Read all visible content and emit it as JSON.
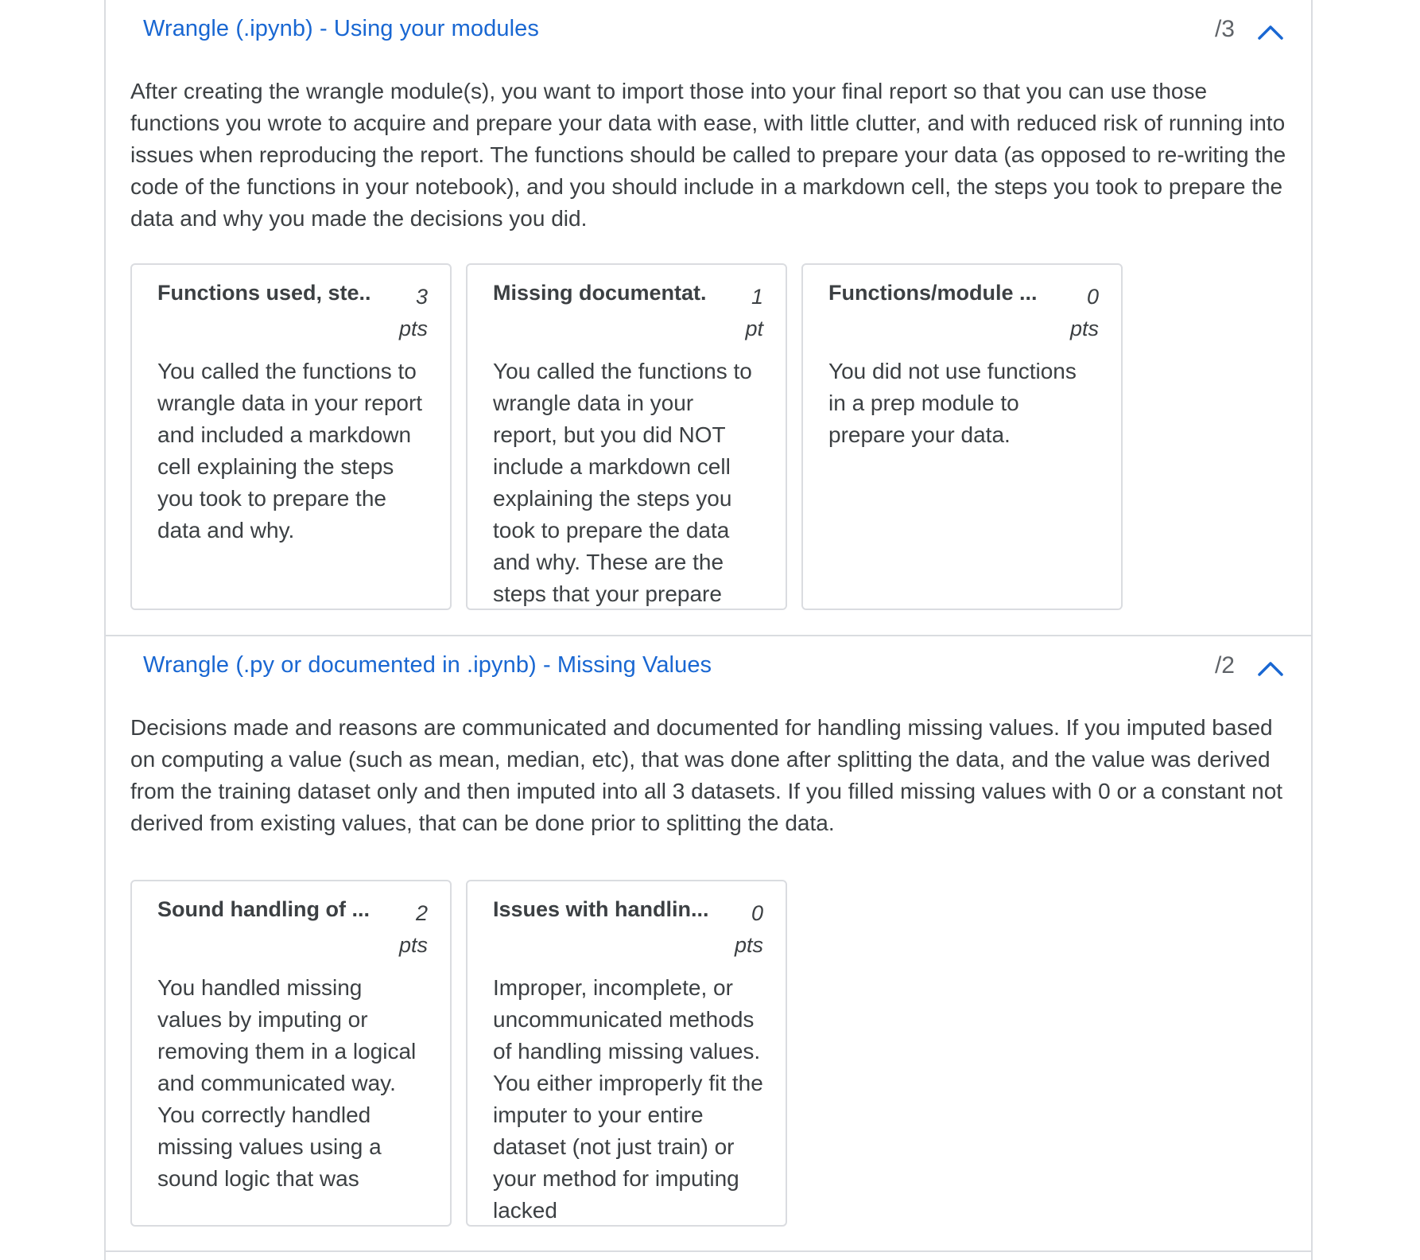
{
  "criteria": [
    {
      "title": "Wrangle (.ipynb) - Using your modules",
      "points": "/3",
      "description": "After creating the wrangle module(s), you want to import those into your final report so that you can use those functions you wrote to acquire and prepare your data with ease, with little clutter, and with reduced risk of running into issues when reproducing the report. The functions should be called to prepare your data (as opposed to re-writing the code of the functions in your notebook), and you should include in a markdown cell, the steps you took to prepare the data and why you made the decisions you did.",
      "ratings": [
        {
          "title": "Functions used, ste...",
          "points_value": "3",
          "points_unit": "pts",
          "description": "You called the functions to wrangle data in your report and included a markdown cell explaining the steps you took to prepare the data and why."
        },
        {
          "title": "Missing documentat...",
          "points_value": "1",
          "points_unit": "pt",
          "description": "You called the functions to wrangle data in your report, but you did NOT include a markdown cell explaining the steps you took to prepare the data and why. These are the steps that your prepare"
        },
        {
          "title": "Functions/module ...",
          "points_value": "0",
          "points_unit": "pts",
          "description": "You did not use functions in a prep module to prepare your data."
        }
      ]
    },
    {
      "title": "Wrangle (.py or documented in .ipynb) - Missing Values",
      "points": "/2",
      "description": "Decisions made and reasons are communicated and documented for handling missing values. If you imputed based on computing a value (such as mean, median, etc), that was done after splitting the data, and the value was derived from the training dataset only and then imputed into all 3 datasets. If you filled missing values with 0 or a constant not derived from existing values, that can be done prior to splitting the data.",
      "ratings": [
        {
          "title": "Sound handling of ...",
          "points_value": "2",
          "points_unit": "pts",
          "description": "You handled missing values by imputing or removing them in a logical and communicated way. You correctly handled missing values using a sound logic that was"
        },
        {
          "title": "Issues with handlin...",
          "points_value": "0",
          "points_unit": "pts",
          "description": "Improper, incomplete, or uncommunicated methods of handling missing values. You either improperly fit the imputer to your entire dataset (not just train) or your method for imputing lacked"
        }
      ]
    }
  ],
  "icons": {
    "collapse": "chevron-up-icon"
  },
  "colors": {
    "link": "#1967d2",
    "text": "#3c4043",
    "border": "#dadce0",
    "muted": "#5f6368"
  }
}
